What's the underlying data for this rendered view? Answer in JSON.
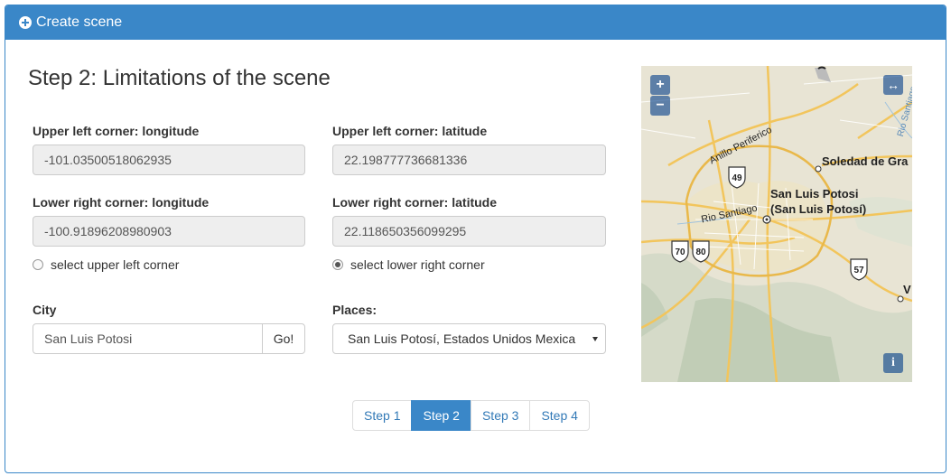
{
  "panel": {
    "title": "Create scene"
  },
  "step_title": "Step 2: Limitations of the scene",
  "upper_left": {
    "lon_label": "Upper left corner: longitude",
    "lon_value": "-101.03500518062935",
    "lat_label": "Upper left corner: latitude",
    "lat_value": "22.198777736681336"
  },
  "lower_right": {
    "lon_label": "Lower right corner: longitude",
    "lon_value": "-100.91896208980903",
    "lat_label": "Lower right corner: latitude",
    "lat_value": "22.118650356099295"
  },
  "radios": {
    "upper_left": {
      "label": "select upper left corner",
      "checked": false
    },
    "lower_right": {
      "label": "select lower right corner",
      "checked": true
    }
  },
  "city": {
    "label": "City",
    "value": "San Luis Potosi",
    "go_label": "Go!"
  },
  "places": {
    "label": "Places:",
    "selected": "San Luis Potosí, Estados Unidos Mexica"
  },
  "map": {
    "zoom_in": "+",
    "zoom_out": "−",
    "fullscreen": "↔",
    "info": "i",
    "labels": {
      "city": "San Luis Potosi",
      "city_sub": "(San Luis Potosí)",
      "soledad": "Soledad de Gra",
      "periferico": "Anillo Periferico",
      "rio_santiago": "Rio Santiago",
      "rio_right": "Rio Santiago",
      "v": "V"
    },
    "shields": [
      "49",
      "70",
      "80",
      "57"
    ]
  },
  "pagination": [
    {
      "label": "Step 1",
      "active": false
    },
    {
      "label": "Step 2",
      "active": true
    },
    {
      "label": "Step 3",
      "active": false
    },
    {
      "label": "Step 4",
      "active": false
    }
  ]
}
